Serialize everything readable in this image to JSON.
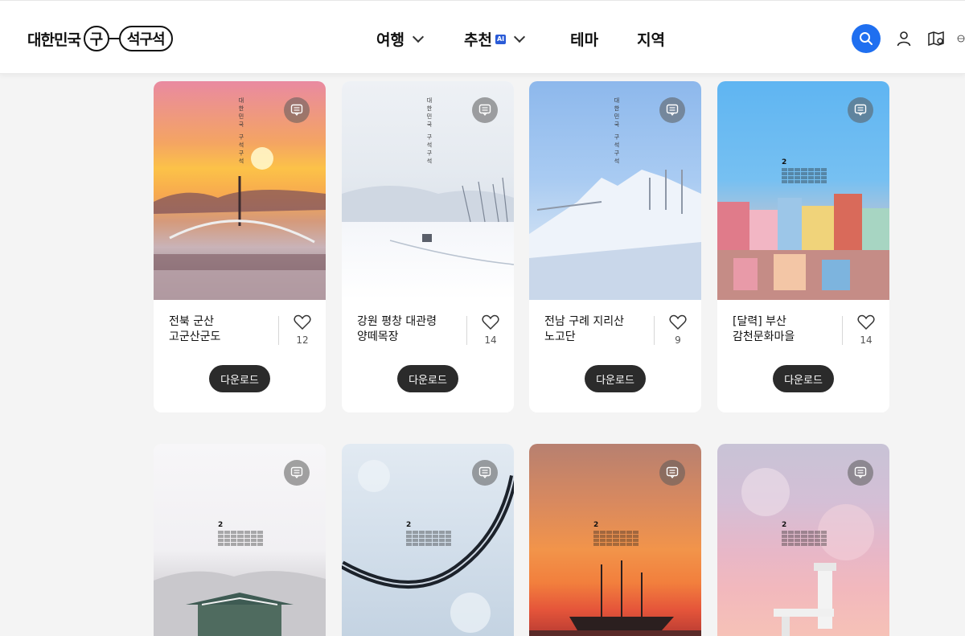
{
  "header": {
    "logo_text": "대한민국",
    "logo_mark_left": "구",
    "logo_mark_right": "석구석",
    "nav": [
      {
        "label": "여행",
        "has_dropdown": true
      },
      {
        "label": "추천",
        "badge": "AI",
        "has_dropdown": true
      },
      {
        "label": "테마",
        "has_dropdown": false
      },
      {
        "label": "지역",
        "has_dropdown": false
      }
    ],
    "icons": [
      "search-icon",
      "user-icon",
      "map-icon",
      "globe-icon"
    ],
    "accent": "#1f6ff0"
  },
  "vertical_caption": "대한민국 구석구석",
  "cards_row1": [
    {
      "title_line1": "전북 군산",
      "title_line2": "고군산군도",
      "likes": "12",
      "download": "다운로드"
    },
    {
      "title_line1": "강원 평창 대관령",
      "title_line2": "양떼목장",
      "likes": "14",
      "download": "다운로드"
    },
    {
      "title_line1": "전남 구례 지리산",
      "title_line2": "노고단",
      "likes": "9",
      "download": "다운로드"
    },
    {
      "title_line1": "[달력] 부산",
      "title_line2": "감천문화마을",
      "likes": "14",
      "download": "다운로드"
    }
  ],
  "calendar_month": "2"
}
